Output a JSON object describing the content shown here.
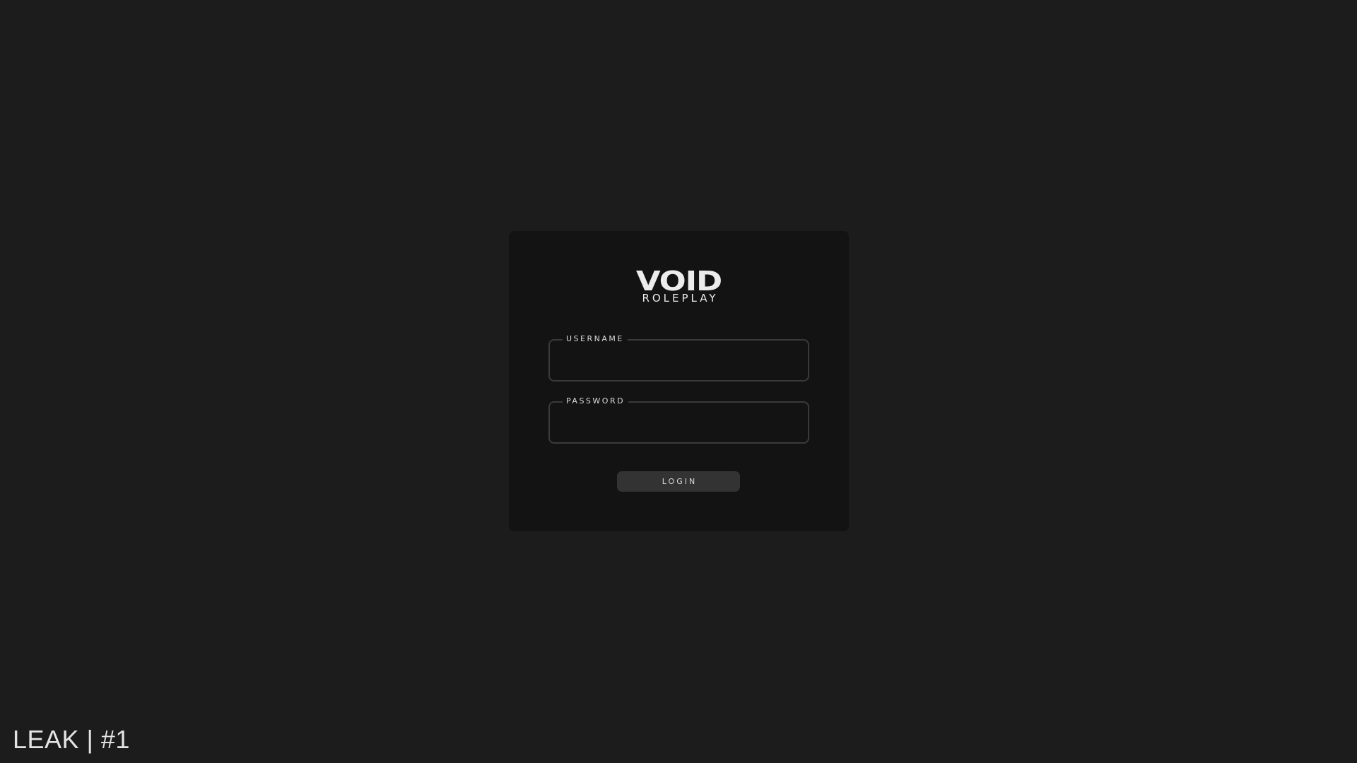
{
  "logo": {
    "main": "VOID",
    "sub": "ROLEPLAY"
  },
  "form": {
    "username_label": "USERNAME",
    "username_value": "",
    "password_label": "PASSWORD",
    "password_value": "",
    "login_label": "LOGIN"
  },
  "watermark": "LEAK | #1",
  "colors": {
    "background": "#1c1c1c",
    "card": "#131313",
    "field_border": "#3a3a3a",
    "button": "#333333",
    "text": "#e4e4e4"
  }
}
